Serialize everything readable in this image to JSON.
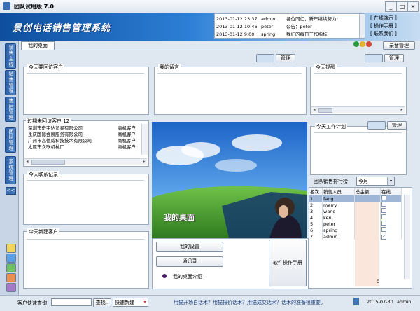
{
  "window": {
    "title": "团队试用版 7.0"
  },
  "header": {
    "brand": "景创电话销售管理系统",
    "messages": [
      {
        "time": "2013-01-12 23:37",
        "user": "admin",
        "text": "各位同仁，新年继续努力!"
      },
      {
        "time": "2013-01-12 10:46",
        "user": "peter",
        "text": "公告：peter"
      },
      {
        "time": "2013-01-12 9:00",
        "user": "spring",
        "text": "我们的每日工作指标"
      }
    ],
    "links": [
      "[ 在线演示 ]",
      "[ 操作手册 ]",
      "[ 联系我们 ]"
    ]
  },
  "tabs": {
    "desktop": "我的桌面",
    "record_manage": "录音管理"
  },
  "sidebar": {
    "tabs": [
      "销售主线",
      "销售管理",
      "售后管理",
      "团队管理",
      "系统管理"
    ],
    "collapse": "<<"
  },
  "panels": {
    "manage_label": "管理",
    "revisit_today": "今天要回访客户",
    "my_message": "我的留言",
    "reminder": "今天提醒",
    "overdue": "过期未回访客户 12",
    "overdue_rows": [
      {
        "name": "深圳市奇宇达贸易有限公司",
        "type": "商机客户"
      },
      {
        "name": "永庆国际会展服务有限公司",
        "type": "商机客户"
      },
      {
        "name": "广州市高德威科技技术有限公司",
        "type": "商机客户"
      },
      {
        "name": "太原市众联机械厂",
        "type": "商机客户"
      }
    ],
    "contact_today": "今天联系记录",
    "new_customer": "今天新建客户",
    "work_plan": "今天工作计划",
    "picture_label": "我的桌面"
  },
  "desktop_buttons": {
    "settings": "我的设置",
    "contacts": "通讯录",
    "manual": "软件操作手册",
    "intro": "我的桌面介绍"
  },
  "ranking": {
    "title": "团队销售排行榜",
    "period": "今月",
    "columns": [
      "名次",
      "销售人员",
      "总金额",
      "在线"
    ],
    "rows": [
      {
        "rank": "1",
        "name": "fang",
        "amount": "",
        "online": false
      },
      {
        "rank": "2",
        "name": "merry",
        "amount": "",
        "online": false
      },
      {
        "rank": "3",
        "name": "wang",
        "amount": "",
        "online": false
      },
      {
        "rank": "4",
        "name": "ken",
        "amount": "",
        "online": false
      },
      {
        "rank": "5",
        "name": "peter",
        "amount": "",
        "online": false
      },
      {
        "rank": "6",
        "name": "spring",
        "amount": "",
        "online": false
      },
      {
        "rank": "7",
        "name": "admin",
        "amount": "",
        "online": true
      }
    ],
    "total": "0"
  },
  "statusbar": {
    "quick_search_label": "客户快速查询",
    "search_button": "查找..",
    "quick_new": "快速新建",
    "marquee": "用猫开场白话术？用猫报价话术？用猫成交话术？话术的准备很重要。",
    "date": "2015-07-30",
    "user": "admin"
  },
  "colors": {
    "banner": "#1f63b8",
    "accent": "#2d5fa3",
    "ranking_highlight": "#9fb6d6"
  }
}
